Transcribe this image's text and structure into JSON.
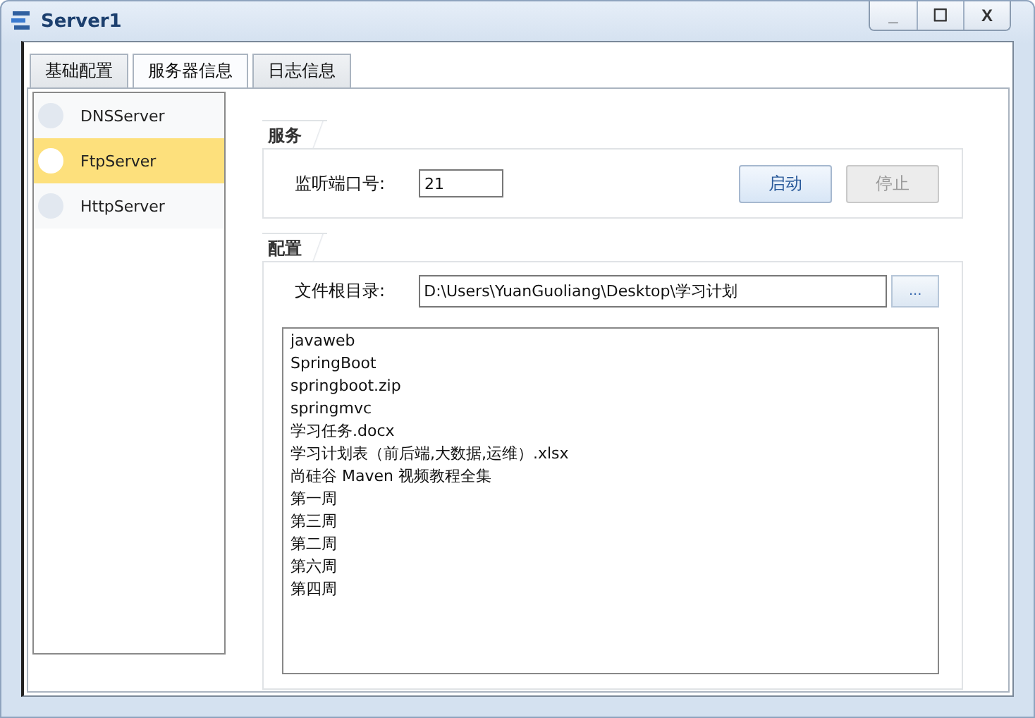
{
  "window": {
    "title": "Server1",
    "controls": [
      "_",
      "☐",
      "X"
    ]
  },
  "tabs": [
    {
      "label": "基础配置",
      "selected": false
    },
    {
      "label": "服务器信息",
      "selected": true
    },
    {
      "label": "日志信息",
      "selected": false
    }
  ],
  "sidebar": {
    "items": [
      {
        "label": "DNSServer",
        "selected": false
      },
      {
        "label": "FtpServer",
        "selected": true
      },
      {
        "label": "HttpServer",
        "selected": false
      }
    ]
  },
  "service": {
    "title": "服务",
    "port_label": "监听端口号:",
    "port_value": "21",
    "buttons": [
      {
        "label": "启动",
        "disabled": false
      },
      {
        "label": "停止",
        "disabled": true
      }
    ]
  },
  "config": {
    "title": "配置",
    "root_label": "文件根目录:",
    "root_value": "D:\\Users\\YuanGuoliang\\Desktop\\学习计划",
    "browse": "...",
    "files": [
      "javaweb",
      "SpringBoot",
      "springboot.zip",
      "springmvc",
      "学习任务.docx",
      "学习计划表（前后端,大数据,运维）.xlsx",
      "尚硅谷 Maven 视频教程全集",
      "第一周",
      "第三周",
      "第二周",
      "第六周",
      "第四周"
    ]
  }
}
